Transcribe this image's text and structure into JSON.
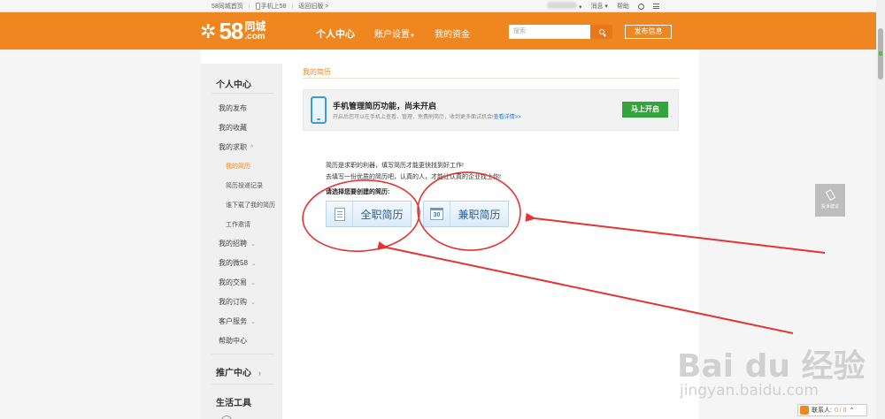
{
  "topbar": {
    "home": "58同城首页",
    "mobile": "手机上58",
    "old": "返回旧版 >",
    "messages": "消息",
    "help": "帮助"
  },
  "header": {
    "logo_num": "58",
    "logo_cn": "同城",
    "logo_en": ".com",
    "nav": [
      {
        "label": "个人中心"
      },
      {
        "label": "账户设置"
      },
      {
        "label": "我的资金"
      }
    ],
    "search_placeholder": "搜索",
    "publish": "发布信息"
  },
  "sidebar": {
    "personal_center": "个人中心",
    "items": [
      {
        "label": "我的发布"
      },
      {
        "label": "我的收藏"
      },
      {
        "label": "我的求职"
      }
    ],
    "sub_items": [
      {
        "label": "我的简历"
      },
      {
        "label": "简历投递记录"
      },
      {
        "label": "谁下载了我的简历"
      },
      {
        "label": "工作邀请"
      }
    ],
    "more_items": [
      {
        "label": "我的招聘"
      },
      {
        "label": "我的微58"
      },
      {
        "label": "我的交易"
      },
      {
        "label": "我的订购"
      },
      {
        "label": "客户服务"
      },
      {
        "label": "帮助中心"
      }
    ],
    "promo_center": "推广中心",
    "life_tools": "生活工具"
  },
  "content": {
    "breadcrumb": "我的简历",
    "banner_title": "手机管理简历功能，尚未开启",
    "banner_desc": "开启后您可以在手机上查看、管理、免费刷简历，收到更多面试机会!",
    "banner_link": "查看详情>>",
    "open_button": "马上开启",
    "intro_line1": "简历是求职的利器，填写简历才能更快找到好工作!",
    "intro_line2": "去填写一份优质的简历吧，认真的人，才能让认真的企业找上你!",
    "choose_label": "请选择您要创建的简历:",
    "fulltime_label": "全职简历",
    "parttime_label": "兼职简历",
    "calendar_num": "30"
  },
  "feedback": "投诉建议",
  "chat": {
    "label": "联系人:",
    "count": "0 / 0"
  },
  "watermark": {
    "main": "Bai du 经验",
    "sub": "jingyan.baidu.com"
  },
  "colors": {
    "brand_orange": "#f0861f",
    "green": "#35a33b",
    "annotation_red": "#e53333"
  }
}
